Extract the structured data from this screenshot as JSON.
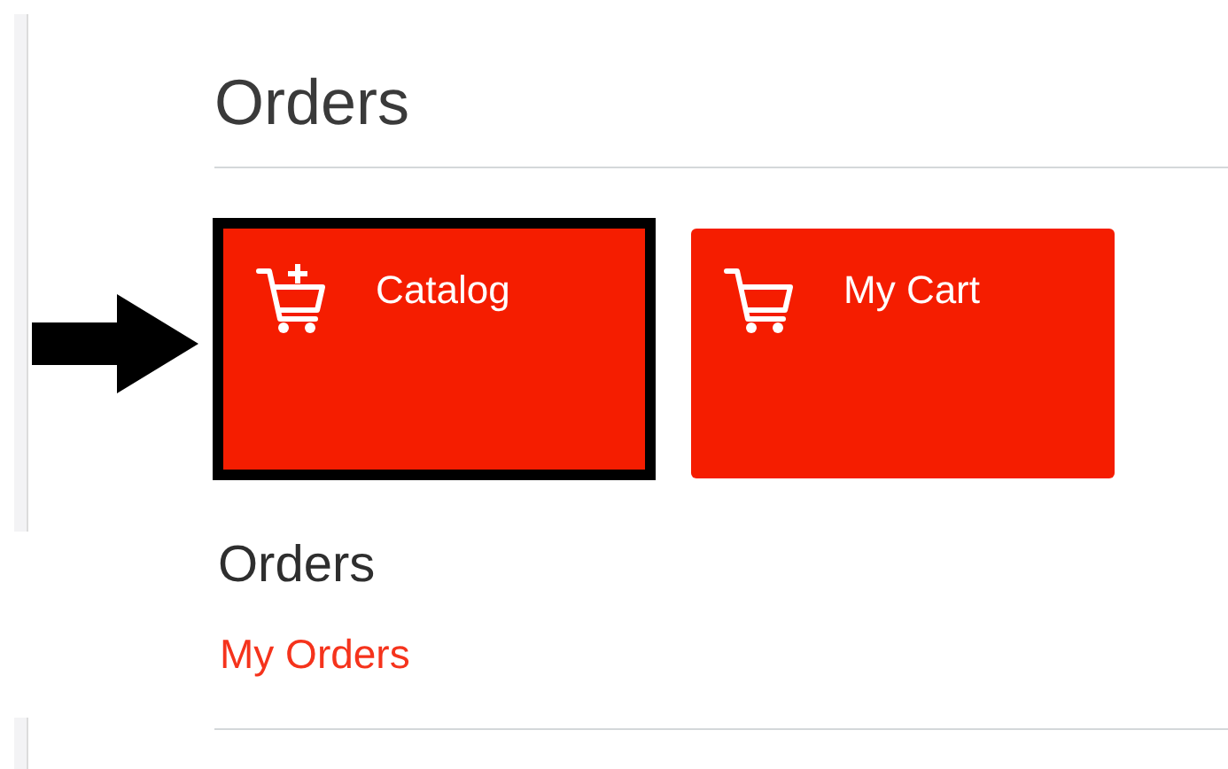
{
  "heading": "Orders",
  "tiles": [
    {
      "label": "Catalog",
      "kind": "catalog",
      "highlighted": true
    },
    {
      "label": "My Cart",
      "kind": "cart",
      "highlighted": false
    }
  ],
  "section": {
    "title": "Orders",
    "links": [
      "My Orders"
    ]
  }
}
